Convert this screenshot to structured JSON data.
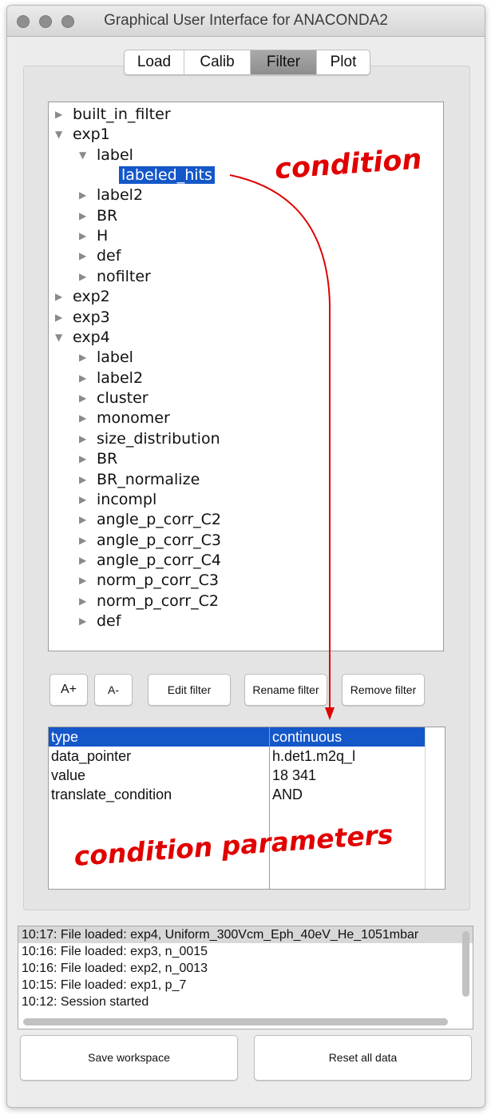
{
  "window": {
    "title": "Graphical User Interface for ANACONDA2"
  },
  "tabs": [
    {
      "label": "Load"
    },
    {
      "label": "Calib"
    },
    {
      "label": "Filter",
      "active": true
    },
    {
      "label": "Plot"
    }
  ],
  "tree": [
    {
      "label": "built_in_filter"
    },
    {
      "label": "exp1"
    },
    {
      "label": "label"
    },
    {
      "label": "labeled_hits",
      "selected": true
    },
    {
      "label": "label2"
    },
    {
      "label": "BR"
    },
    {
      "label": "H"
    },
    {
      "label": "def"
    },
    {
      "label": "nofilter"
    },
    {
      "label": "exp2"
    },
    {
      "label": "exp3"
    },
    {
      "label": "exp4"
    },
    {
      "label": "label"
    },
    {
      "label": "label2"
    },
    {
      "label": "cluster"
    },
    {
      "label": "monomer"
    },
    {
      "label": "size_distribution"
    },
    {
      "label": "BR"
    },
    {
      "label": "BR_normalize"
    },
    {
      "label": "incompl"
    },
    {
      "label": "angle_p_corr_C2"
    },
    {
      "label": "angle_p_corr_C3"
    },
    {
      "label": "angle_p_corr_C4"
    },
    {
      "label": "norm_p_corr_C3"
    },
    {
      "label": "norm_p_corr_C2"
    },
    {
      "label": "def"
    }
  ],
  "buttons": {
    "a_plus": "A+",
    "a_minus": "A-",
    "edit_filter": "Edit filter",
    "rename_filter": "Rename filter",
    "remove_filter": "Remove filter"
  },
  "parameters": {
    "rows": [
      {
        "name": "type",
        "value": "continuous",
        "selected": true
      },
      {
        "name": "data_pointer",
        "value": "h.det1.m2q_l"
      },
      {
        "name": "value",
        "value": "18  341"
      },
      {
        "name": "translate_condition",
        "value": "AND"
      }
    ]
  },
  "log": [
    "10:17: File loaded: exp4, Uniform_300Vcm_Eph_40eV_He_1051mbar",
    "10:16: File loaded: exp3, n_0015",
    "10:16: File loaded: exp2, n_0013",
    "10:15: File loaded: exp1, p_7",
    "10:12: Session started"
  ],
  "footer": {
    "save_workspace": "Save workspace",
    "reset_all_data": "Reset all data"
  },
  "annotations": {
    "condition": "condition",
    "condition_parameters": "condition parameters",
    "color": "#e00000"
  },
  "colors": {
    "selection": "#1457c9"
  }
}
